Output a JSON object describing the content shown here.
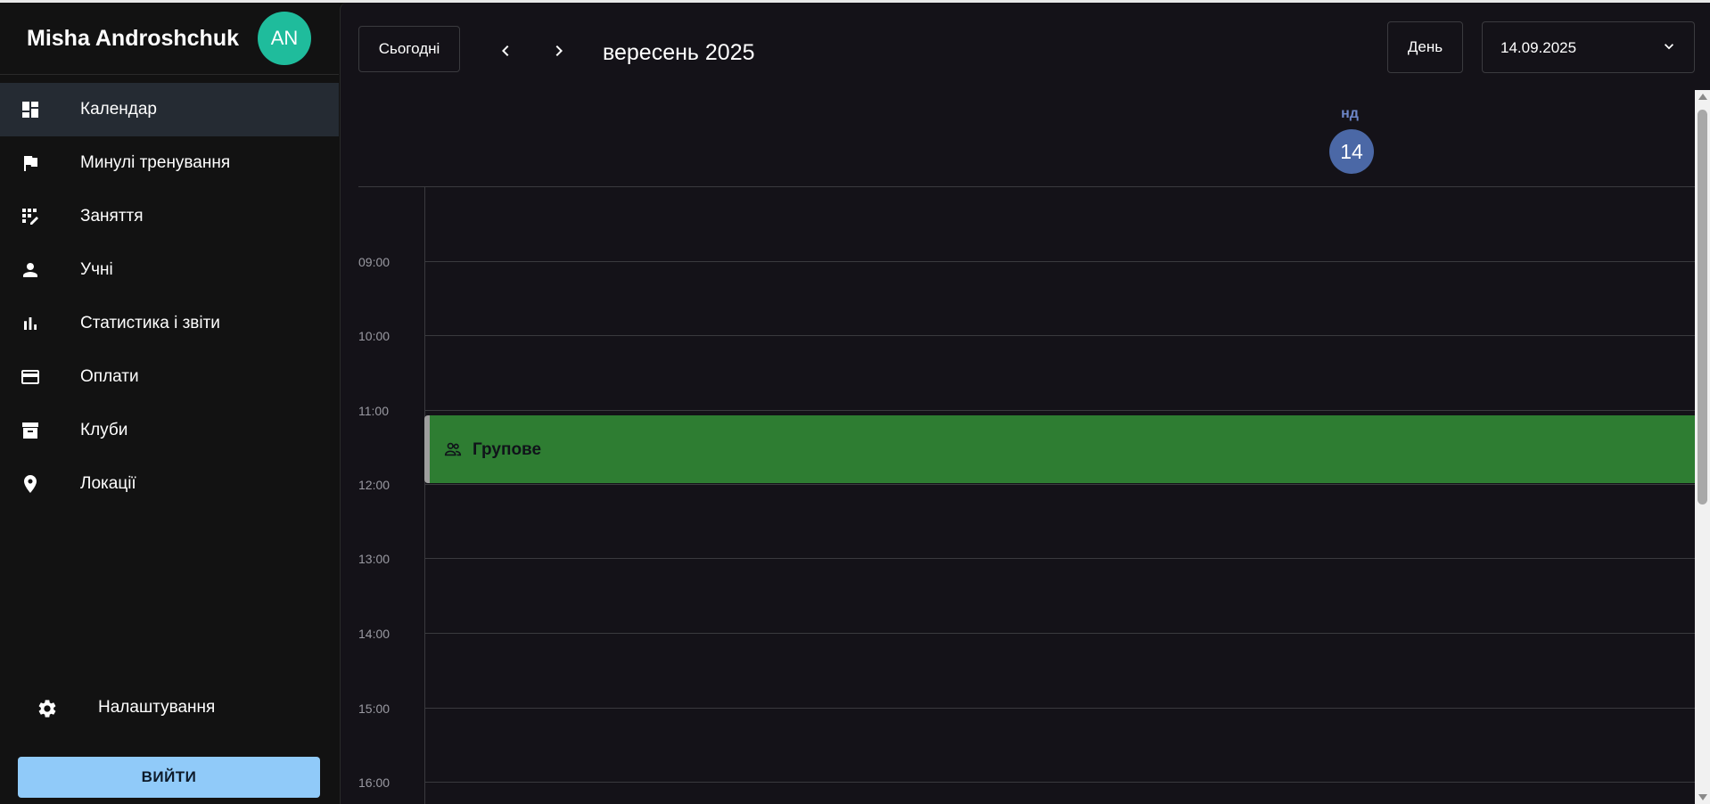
{
  "sidebar": {
    "user_name": "Misha Androshchuk",
    "avatar_initials": "AN",
    "items": [
      {
        "label": "Календар",
        "icon": "dashboard-icon",
        "active": true
      },
      {
        "label": "Минулі тренування",
        "icon": "flag-icon",
        "active": false
      },
      {
        "label": "Заняття",
        "icon": "edit-grid-icon",
        "active": false
      },
      {
        "label": "Учні",
        "icon": "person-icon",
        "active": false
      },
      {
        "label": "Статистика і звіти",
        "icon": "bar-chart-icon",
        "active": false
      },
      {
        "label": "Оплати",
        "icon": "credit-card-icon",
        "active": false
      },
      {
        "label": "Клуби",
        "icon": "archive-icon",
        "active": false
      },
      {
        "label": "Локації",
        "icon": "location-pin-icon",
        "active": false
      }
    ],
    "settings_label": "Налаштування",
    "logout_label": "ВИЙТИ"
  },
  "toolbar": {
    "today_label": "Сьогодні",
    "month_title": "вересень 2025",
    "view_label": "День",
    "date_value": "14.09.2025"
  },
  "day_header": {
    "day_name": "нд",
    "day_number": "14"
  },
  "time_labels": [
    "09:00",
    "10:00",
    "11:00",
    "12:00",
    "13:00",
    "14:00",
    "15:00",
    "16:00"
  ],
  "events": [
    {
      "title": "Групове",
      "icon": "group-icon",
      "start": "11:00",
      "end": "12:00"
    }
  ],
  "colors": {
    "accent": "#90caf9",
    "avatar": "#1fbc9c",
    "event": "#2e7d32",
    "today_circle": "#4b68a6",
    "background": "#141218"
  }
}
